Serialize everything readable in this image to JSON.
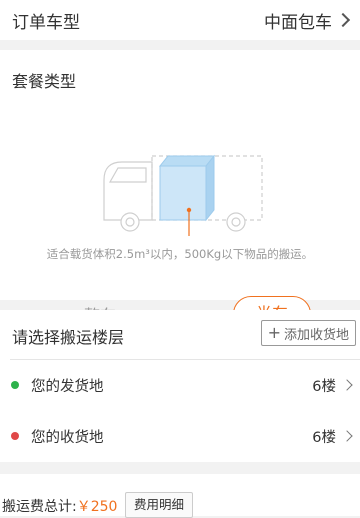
{
  "order": {
    "label": "订单车型",
    "value": "中面包车"
  },
  "package": {
    "title": "套餐类型",
    "description": "适合载货体积2.5m³以内，500Kg以下物品的搬运。",
    "options": [
      {
        "label": "整车",
        "selected": false
      },
      {
        "label": "半车",
        "selected": true
      }
    ]
  },
  "floors": {
    "title": "请选择搬运楼层",
    "add_button": "添加收货地",
    "origin": {
      "label": "您的发货地",
      "value": "6楼",
      "dot_color": "#2db24b"
    },
    "destination": {
      "label": "您的收货地",
      "value": "6楼",
      "dot_color": "#e04848"
    }
  },
  "footer": {
    "fee_label": "搬运费总计:",
    "fee_value": "￥250",
    "detail_button": "费用明细"
  },
  "colors": {
    "accent": "#f0711f",
    "cargo_blue": "#cde6f8"
  }
}
